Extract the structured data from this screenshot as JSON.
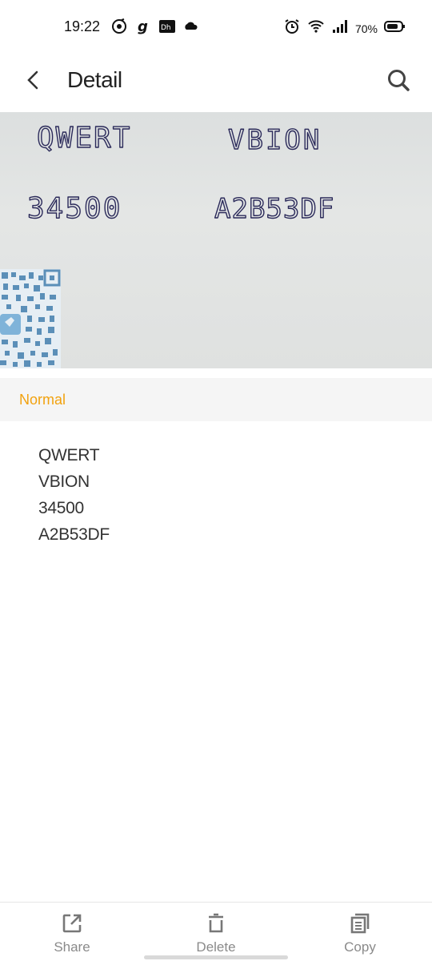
{
  "status": {
    "time": "19:22",
    "battery": "70%",
    "left_icons": [
      "music-icon",
      "g-app-icon",
      "dh-app-icon",
      "cloud-icon"
    ],
    "right_icons": [
      "alarm-icon",
      "wifi-icon",
      "signal-icon",
      "battery-icon"
    ]
  },
  "header": {
    "title": "Detail",
    "back_icon": "chevron-left-icon",
    "search_icon": "search-icon"
  },
  "photo": {
    "handwritten": [
      "QWERT",
      "VBION",
      "34500",
      "A2B53DF"
    ]
  },
  "mode": {
    "label": "Normal",
    "color": "#f2a20f"
  },
  "result": {
    "lines": [
      "QWERT",
      "VBION",
      "34500",
      "A2B53DF"
    ]
  },
  "actions": {
    "share": "Share",
    "delete": "Delete",
    "copy": "Copy"
  }
}
